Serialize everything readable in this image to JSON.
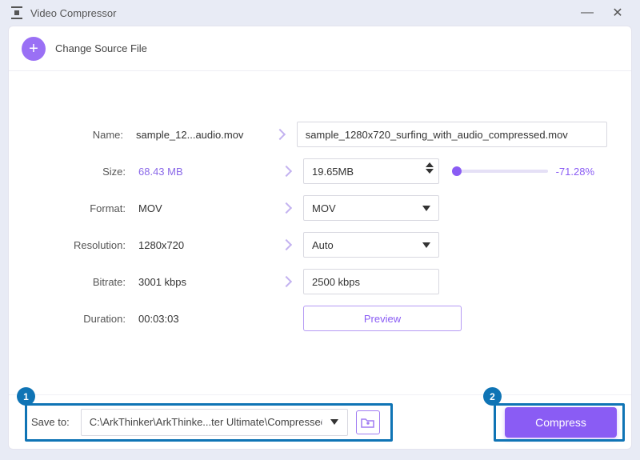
{
  "window": {
    "title": "Video Compressor"
  },
  "header": {
    "change_source": "Change Source File"
  },
  "labels": {
    "name": "Name:",
    "size": "Size:",
    "format": "Format:",
    "resolution": "Resolution:",
    "bitrate": "Bitrate:",
    "duration": "Duration:",
    "save_to": "Save to:"
  },
  "source": {
    "name": "sample_12...audio.mov",
    "size": "68.43 MB",
    "format": "MOV",
    "resolution": "1280x720",
    "bitrate": "3001 kbps",
    "duration": "00:03:03"
  },
  "target": {
    "name": "sample_1280x720_surfing_with_audio_compressed.mov",
    "size": "19.65MB",
    "format": "MOV",
    "resolution": "Auto",
    "bitrate": "2500 kbps"
  },
  "reduction_pct": "-71.28%",
  "preview_label": "Preview",
  "save_path": "C:\\ArkThinker\\ArkThinke...ter Ultimate\\Compressed",
  "compress_label": "Compress",
  "callouts": {
    "one": "1",
    "two": "2"
  }
}
